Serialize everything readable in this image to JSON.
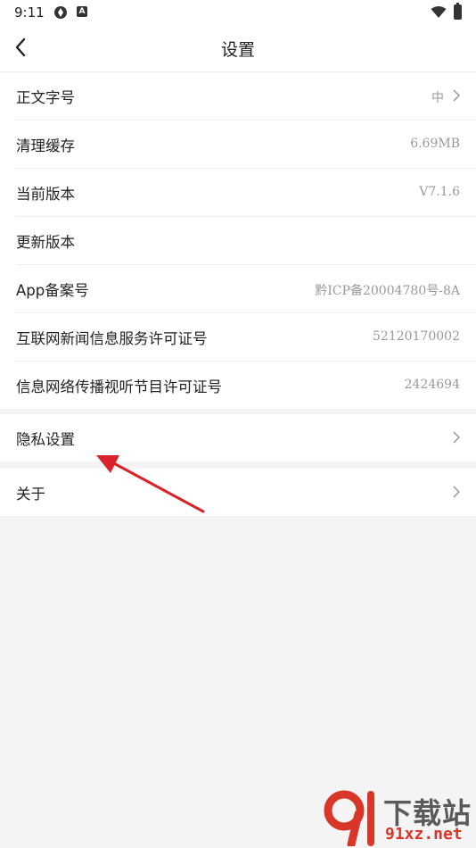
{
  "status_bar": {
    "time": "9:11",
    "icons": [
      "aperture-icon",
      "a-badge-icon",
      "wifi-icon",
      "battery-icon"
    ],
    "badge_letter": "A"
  },
  "nav": {
    "title": "设置",
    "back_icon": "chevron-left-icon"
  },
  "settings_group_1": [
    {
      "label": "正文字号",
      "value": "中",
      "chevron": true
    },
    {
      "label": "清理缓存",
      "value": "6.69MB",
      "chevron": false
    },
    {
      "label": "当前版本",
      "value": "V7.1.6",
      "chevron": false
    },
    {
      "label": "更新版本",
      "value": "",
      "chevron": false
    },
    {
      "label": "App备案号",
      "value": "黔ICP备20004780号-8A",
      "chevron": false
    },
    {
      "label": "互联网新闻信息服务许可证号",
      "value": "52120170002",
      "chevron": false
    },
    {
      "label": "信息网络传播视听节目许可证号",
      "value": "2424694",
      "chevron": false
    }
  ],
  "settings_group_2": [
    {
      "label": "隐私设置",
      "value": "",
      "chevron": true
    }
  ],
  "settings_group_3": [
    {
      "label": "关于",
      "value": "",
      "chevron": true
    }
  ],
  "annotation": {
    "color": "#d9232a"
  },
  "watermark": {
    "top": "下载站",
    "bottom": "91xz.net"
  },
  "colors": {
    "background": "#f4f4f4",
    "card": "#ffffff",
    "text_primary": "#222222",
    "text_secondary": "#999999"
  }
}
